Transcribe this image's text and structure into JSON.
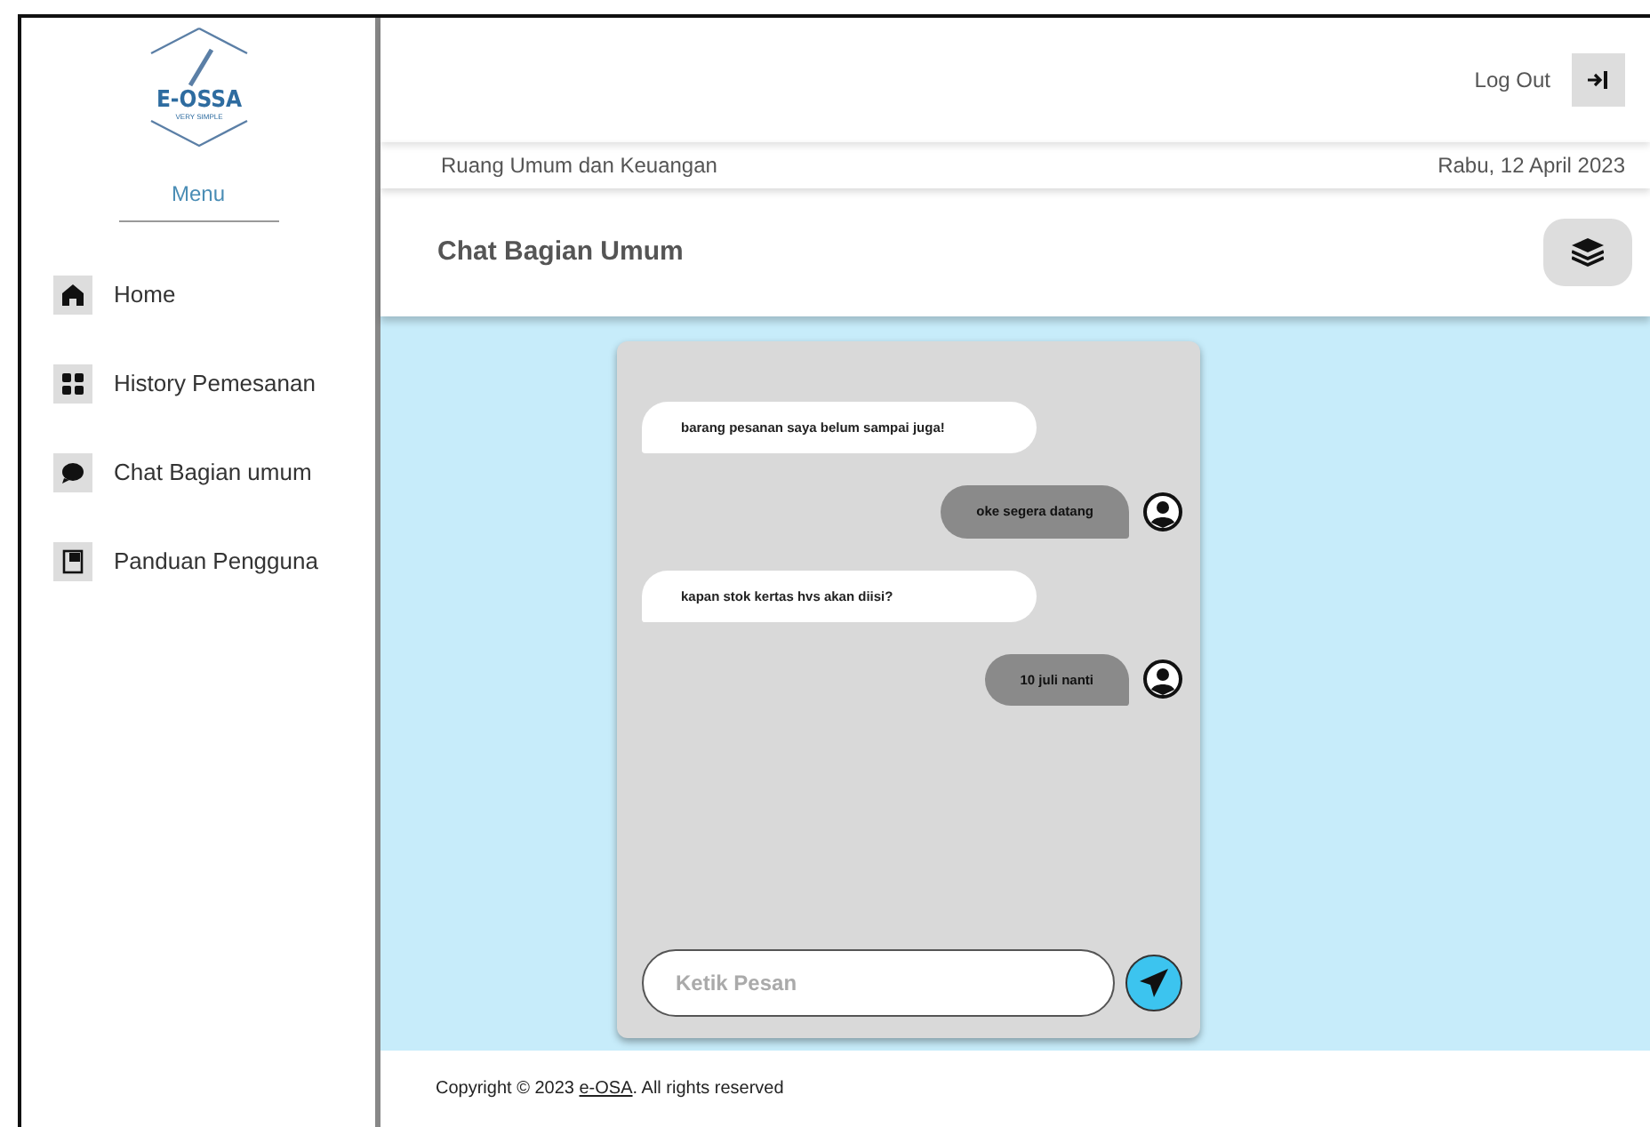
{
  "logo": {
    "name": "E-OSSA",
    "tagline": "VERY SIMPLE"
  },
  "sidebar": {
    "heading": "Menu",
    "items": [
      {
        "label": "Home"
      },
      {
        "label": "History Pemesanan"
      },
      {
        "label": "Chat Bagian umum"
      },
      {
        "label": "Panduan Pengguna"
      }
    ]
  },
  "header": {
    "logout": "Log Out",
    "department": "Ruang Umum dan Keuangan",
    "date": "Rabu, 12 April 2023",
    "title": "Chat Bagian Umum"
  },
  "chat": {
    "messages": [
      {
        "kind": "received",
        "text": "barang pesanan saya belum sampai juga!"
      },
      {
        "kind": "sent",
        "text": "oke segera datang"
      },
      {
        "kind": "received",
        "text": "kapan stok kertas hvs akan diisi?"
      },
      {
        "kind": "sent",
        "text": "10 juli nanti"
      }
    ],
    "input": {
      "placeholder": "Ketik Pesan"
    }
  },
  "footer": {
    "prefix": "Copyright © 2023 ",
    "link": "e-OSA",
    "suffix": ". All rights reserved"
  }
}
